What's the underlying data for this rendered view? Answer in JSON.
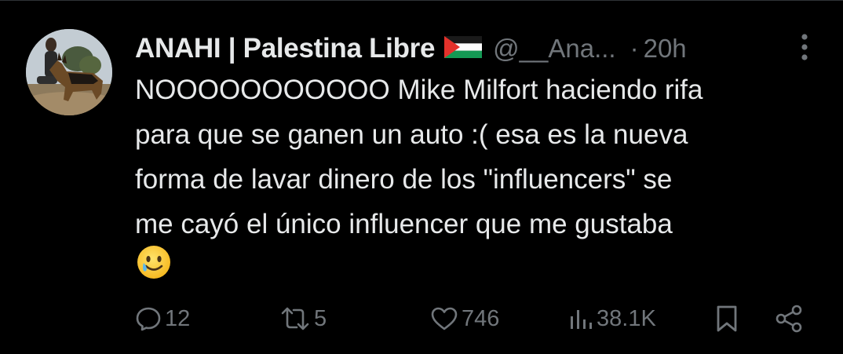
{
  "tweet": {
    "author": {
      "display_name": "ANAHI | Palestina Libre",
      "flag_icon": "palestine-flag-icon",
      "handle": "@__Ana...",
      "separator": "·",
      "time": "20h"
    },
    "text_lines": [
      "NOOOOOOOOOOO Mike Milfort haciendo rifa",
      "para que se ganen un auto :( esa es la nueva",
      "forma de lavar dinero de los \"influencers\" se",
      "me cayó el único influencer que me gustaba"
    ],
    "emoji": "smiling-face-with-tear-emoji",
    "actions": {
      "replies": "12",
      "reposts": "5",
      "likes": "746",
      "views": "38.1K"
    }
  },
  "colors": {
    "background": "#000000",
    "primary_text": "#e7e9ea",
    "secondary_text": "#71767b",
    "divider": "#2f3336",
    "flag_red": "#e4312b",
    "flag_green": "#149954"
  }
}
